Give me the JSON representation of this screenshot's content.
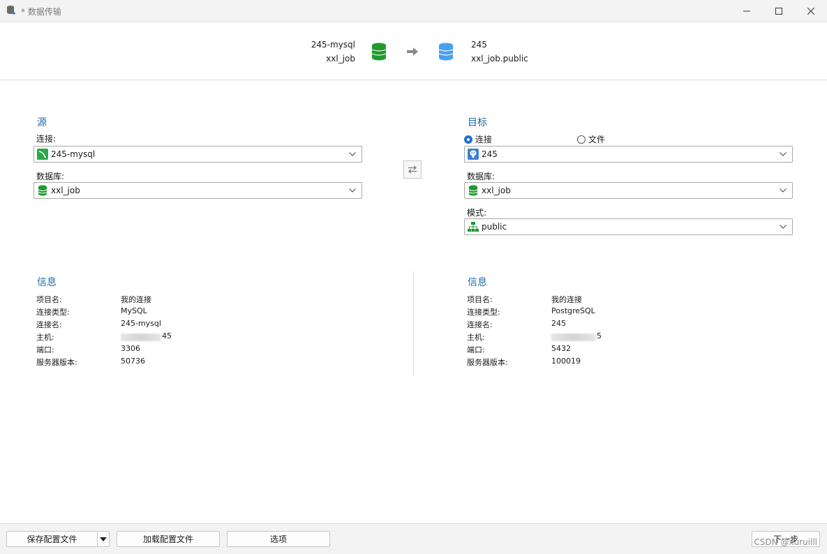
{
  "window": {
    "title": "* 数据传输",
    "icons": {
      "app": "database-transfer-icon",
      "minimize": "minimize-icon",
      "maximize": "maximize-icon",
      "close": "close-icon"
    }
  },
  "header": {
    "source_connection": "245-mysql",
    "source_database": "xxl_job",
    "target_connection": "245",
    "target_database": "xxl_job.public",
    "source_icon": "mysql-database-icon",
    "arrow_icon": "arrow-right-icon",
    "target_icon": "postgresql-database-icon",
    "colors": {
      "source_db": "#1e9b2c",
      "target_db": "#4a9ff0"
    }
  },
  "source": {
    "title": "源",
    "connection_label": "连接:",
    "connection_value": "245-mysql",
    "database_label": "数据库:",
    "database_value": "xxl_job"
  },
  "target": {
    "title": "目标",
    "radio_connection": "连接",
    "radio_file": "文件",
    "connection_value": "245",
    "database_label": "数据库:",
    "database_value": "xxl_job",
    "schema_label": "模式:",
    "schema_value": "public"
  },
  "source_info": {
    "title": "信息",
    "rows": [
      {
        "key": "项目名:",
        "value": "我的连接"
      },
      {
        "key": "连接类型:",
        "value": "MySQL"
      },
      {
        "key": "连接名:",
        "value": "245-mysql"
      },
      {
        "key": "主机:",
        "value": "45"
      },
      {
        "key": "端口:",
        "value": "3306"
      },
      {
        "key": "服务器版本:",
        "value": "50736"
      }
    ]
  },
  "target_info": {
    "title": "信息",
    "rows": [
      {
        "key": "项目名:",
        "value": "我的连接"
      },
      {
        "key": "连接类型:",
        "value": "PostgreSQL"
      },
      {
        "key": "连接名:",
        "value": "245"
      },
      {
        "key": "主机:",
        "value": "5"
      },
      {
        "key": "端口:",
        "value": "5432"
      },
      {
        "key": "服务器版本:",
        "value": "100019"
      }
    ]
  },
  "footer": {
    "save_profile": "保存配置文件",
    "load_profile": "加载配置文件",
    "options": "选项",
    "next": "下一步",
    "watermark": "CSDN @xuruilll"
  },
  "accent": "#1f6aa5"
}
